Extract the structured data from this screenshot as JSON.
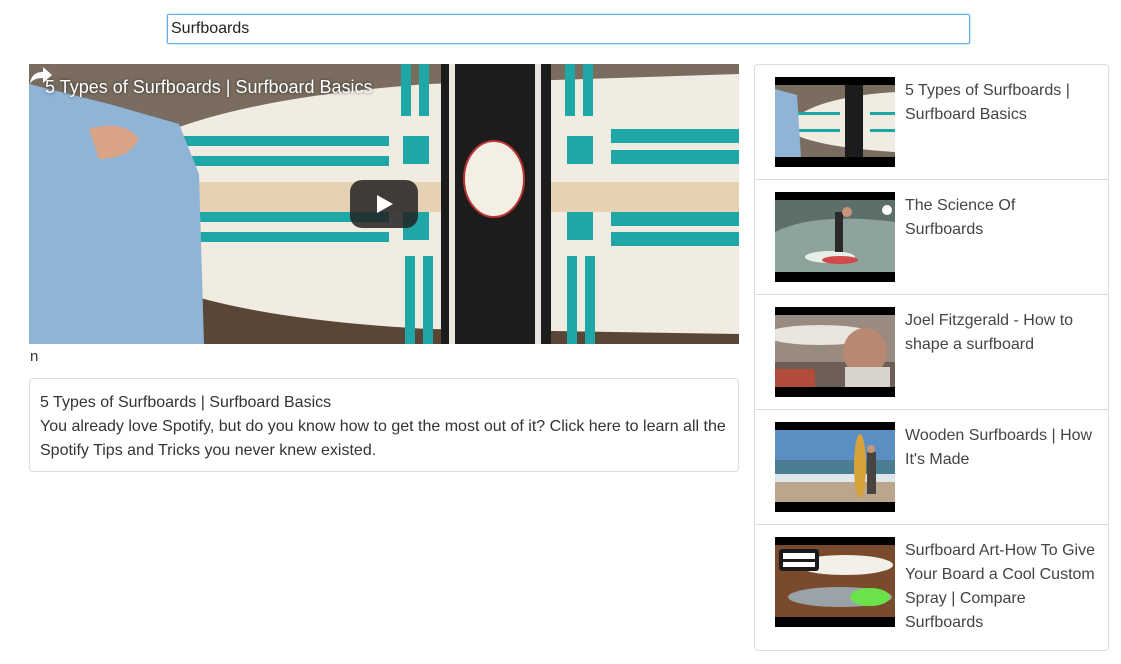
{
  "search": {
    "value": "Surfboards"
  },
  "player": {
    "title": "5 Types of Surfboards | Surfboard Basics",
    "share_icon": "share-arrow-icon",
    "play_icon": "youtube-play-icon"
  },
  "stray_text": "n",
  "description": {
    "title": "5 Types of Surfboards | Surfboard Basics",
    "body": "You already love Spotify, but do you know how to get the most out of it? Click here to learn all the Spotify Tips and Tricks you never knew existed."
  },
  "videos": [
    {
      "title": "5 Types of Surfboards | Surfboard Basics"
    },
    {
      "title": "The Science Of Surfboards"
    },
    {
      "title": "Joel Fitzgerald - How to shape a surfboard"
    },
    {
      "title": "Wooden Surfboards | How It's Made"
    },
    {
      "title": "Surfboard Art-How To Give Your Board a Cool Custom Spray | Compare Surfboards"
    }
  ],
  "colors": {
    "focus_border": "#66afe9",
    "accent_teal": "#1fa6a6",
    "panel_border": "#dddddd"
  }
}
